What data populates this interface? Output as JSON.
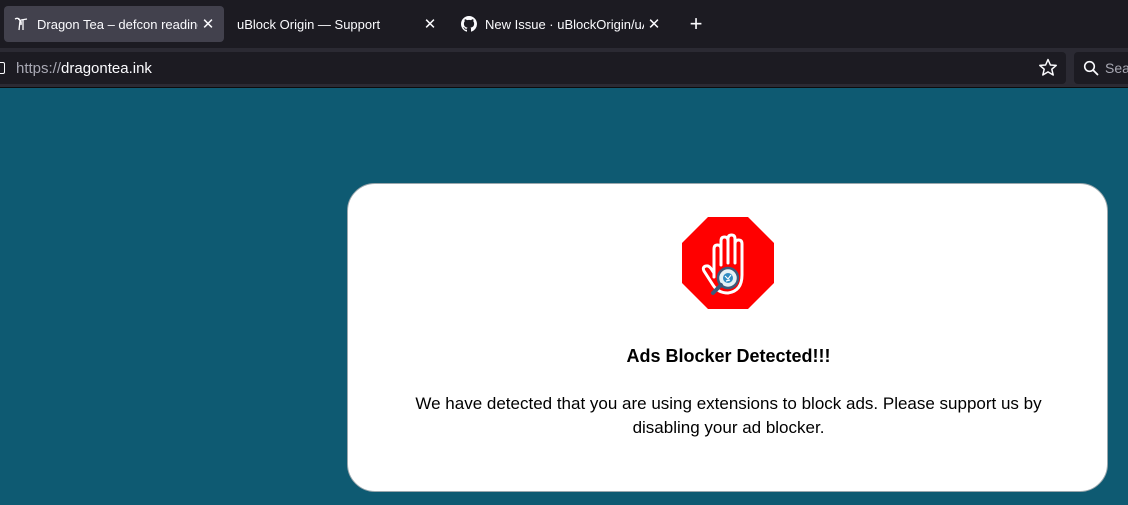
{
  "browser": {
    "tabs": [
      {
        "title": "Dragon Tea – defcon reading lv",
        "favicon": "dragon-tea-favicon",
        "active": true
      },
      {
        "title": "uBlock Origin — Support",
        "favicon": "",
        "active": false
      },
      {
        "title": "New Issue · uBlockOrigin/uAsse",
        "favicon": "github-icon",
        "active": false
      }
    ],
    "close_glyph": "✕",
    "new_tab_glyph": "+",
    "url": {
      "protocol": "https://",
      "host": "dragontea.ink"
    },
    "search_placeholder": "Sear"
  },
  "modal": {
    "title": "Ads Blocker Detected!!!",
    "message": "We have detected that you are using extensions to block ads. Please support us by disabling your ad blocker.",
    "icon": "stop-hand-icon"
  },
  "colors": {
    "page_background": "#0e5a72",
    "modal_background": "#ffffff",
    "stop_sign_red": "#ff0000",
    "browser_chrome": "#1c1b22"
  }
}
